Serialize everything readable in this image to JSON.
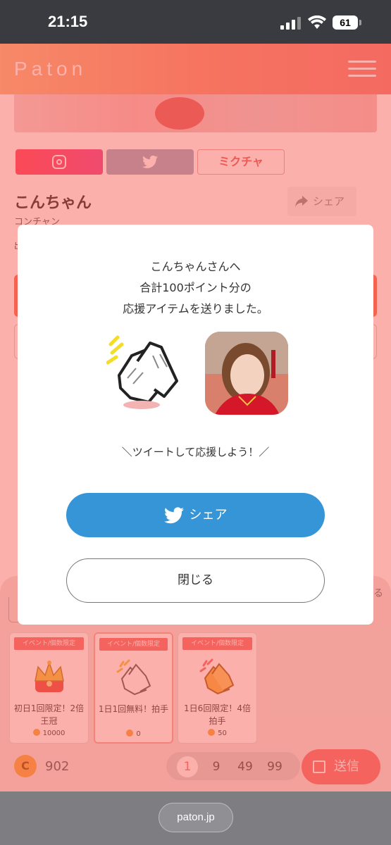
{
  "status_bar": {
    "time": "21:15",
    "battery": "61"
  },
  "header": {
    "logo": "Paton"
  },
  "profile": {
    "mix_label": "ミクチャ",
    "name": "こんちゃん",
    "kana": "コンチャン",
    "share_label": "シェア",
    "partial_label": "出"
  },
  "modal": {
    "line1": "こんちゃんさんへ",
    "line2": "合計100ポイント分の",
    "line3": "応援アイテムを送りました。",
    "hint": "＼ツイートして応援しよう！／",
    "share_button": "シェア",
    "close_button": "閉じる"
  },
  "gift_sheet": {
    "side_hint": "る",
    "items": [
      {
        "tag": "イベント/個数限定",
        "name": "初日1回限定！2倍王冠",
        "price": "10000",
        "icon": "crown-icon"
      },
      {
        "tag": "イベント/個数限定",
        "name": "1日1回無料！拍手",
        "price": "0",
        "icon": "clap-icon"
      },
      {
        "tag": "イベント/個数限定",
        "name": "1日6回限定！4倍拍手",
        "price": "50",
        "icon": "gold-clap-icon"
      }
    ],
    "coin_symbol": "C",
    "balance": "902",
    "quantities": [
      "1",
      "9",
      "49",
      "99"
    ],
    "selected_quantity": "1",
    "send_label": "送信"
  },
  "browser": {
    "url": "paton.jp"
  },
  "colors": {
    "accent": "#f26c6c",
    "twitter": "#3695d6",
    "header_start": "#f7b47e",
    "header_end": "#f27a72"
  }
}
